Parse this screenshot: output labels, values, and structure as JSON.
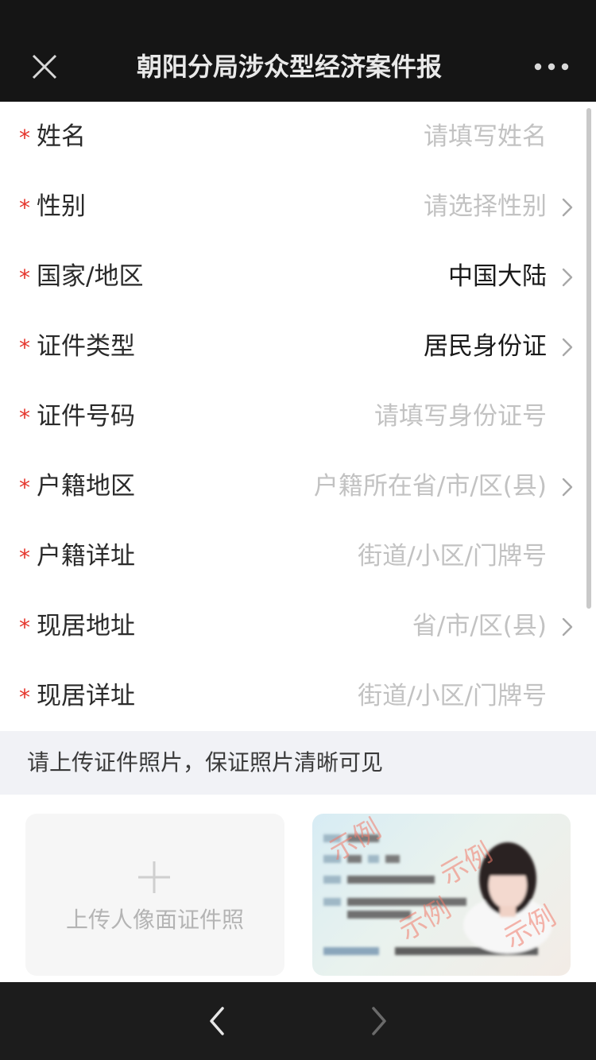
{
  "header": {
    "title": "朝阳分局涉众型经济案件报",
    "close_icon": "close-icon",
    "more_icon": "more-dots-icon",
    "bg_color": "#151515"
  },
  "form": {
    "required_mark": "*",
    "required_color": "#e5352c",
    "fields": [
      {
        "label": "姓名",
        "value": "请填写姓名",
        "is_placeholder": true,
        "has_chevron": false
      },
      {
        "label": "性别",
        "value": "请选择性别",
        "is_placeholder": true,
        "has_chevron": true
      },
      {
        "label": "国家/地区",
        "value": "中国大陆",
        "is_placeholder": false,
        "has_chevron": true
      },
      {
        "label": "证件类型",
        "value": "居民身份证",
        "is_placeholder": false,
        "has_chevron": true
      },
      {
        "label": "证件号码",
        "value": "请填写身份证号",
        "is_placeholder": true,
        "has_chevron": false
      },
      {
        "label": "户籍地区",
        "value": "户籍所在省/市/区(县)",
        "is_placeholder": true,
        "has_chevron": true
      },
      {
        "label": "户籍详址",
        "value": "街道/小区/门牌号",
        "is_placeholder": true,
        "has_chevron": false
      },
      {
        "label": "现居地址",
        "value": "省/市/区(县)",
        "is_placeholder": true,
        "has_chevron": true
      },
      {
        "label": "现居详址",
        "value": "街道/小区/门牌号",
        "is_placeholder": true,
        "has_chevron": false
      }
    ]
  },
  "notice": {
    "text": "请上传证件照片，保证照片清晰可见"
  },
  "upload": {
    "portrait_label": "上传人像面证件照",
    "plus_icon": "plus-icon",
    "sample_watermark": "示例"
  },
  "bottom_nav": {
    "back_icon": "chevron-left-icon",
    "forward_icon": "chevron-right-icon"
  }
}
